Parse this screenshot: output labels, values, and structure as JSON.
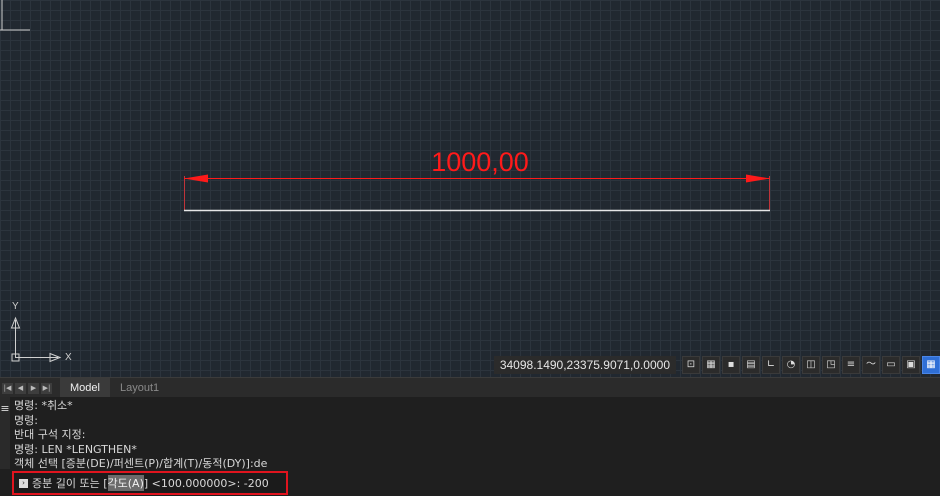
{
  "drawing": {
    "dimension_text": "1000,00",
    "axis_x": "X",
    "axis_y": "Y"
  },
  "status_bar": {
    "coordinates": "34098.1490,23375.9071,0.0000",
    "buttons": [
      "snap",
      "grid-snap",
      "grid",
      "grid-display",
      "ortho",
      "polar",
      "osnap",
      "otrack",
      "lineweight",
      "transparency",
      "cycle",
      "model-space",
      "workspace"
    ]
  },
  "tabs": {
    "nav": [
      "|◀",
      "◀",
      "▶",
      "▶|"
    ],
    "model": "Model",
    "layout": "Layout1"
  },
  "command": {
    "grip": "≡",
    "history": [
      "명령: *취소*",
      "명령:",
      "반대 구석 지정:",
      "명령: LEN *LENGTHEN*",
      "객체 선택 [증분(DE)/퍼센트(P)/합계(T)/동적(DY)]:de"
    ],
    "prompt_before": "증분 길이 또는 [",
    "prompt_highlight": "각도(A)",
    "prompt_after": "] <100.000000>: -200"
  },
  "colors": {
    "canvas_bg": "#212830",
    "dimension": "#ff1a1a",
    "highlight_border": "#e0141e"
  }
}
